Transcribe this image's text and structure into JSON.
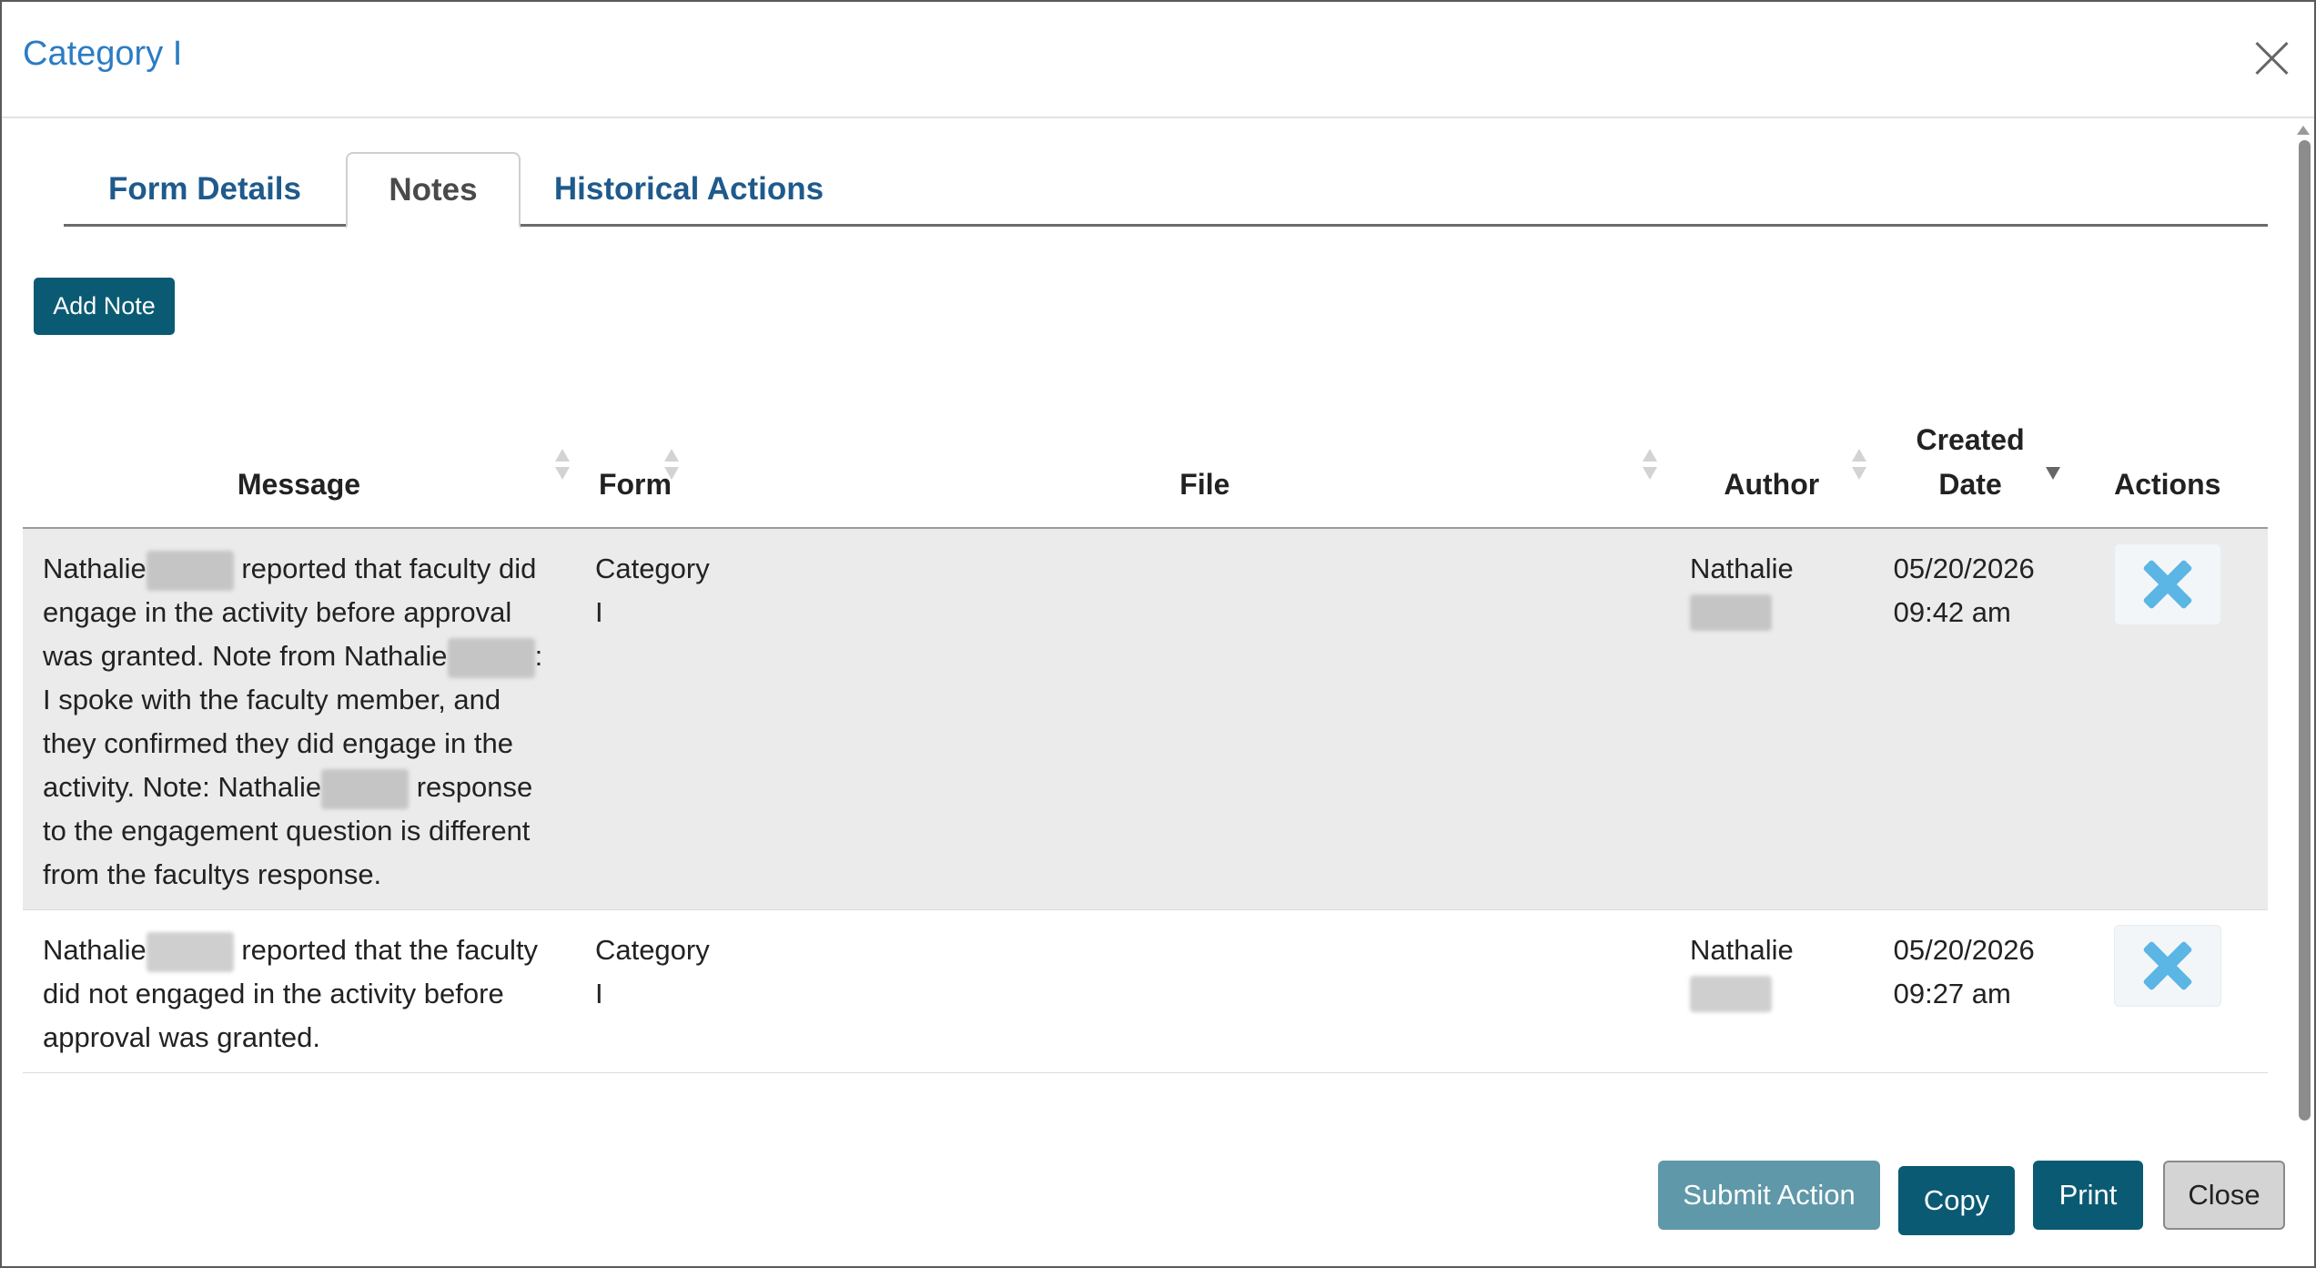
{
  "modal": {
    "title": "Category I"
  },
  "tabs": [
    {
      "label": "Form Details"
    },
    {
      "label": "Notes"
    },
    {
      "label": "Historical Actions"
    }
  ],
  "add_note_label": "Add Note",
  "table": {
    "headers": {
      "message": "Message",
      "form": "Form",
      "file": "File",
      "author": "Author",
      "created_date_line1": "Created",
      "created_date_line2": "Date",
      "actions": "Actions"
    },
    "rows": [
      {
        "message": {
          "p1": "Nathalie",
          "p2": " reported that faculty did engage in the activity before approval was granted. Note from Nathalie",
          "p3": ": I spoke with the faculty member, and they confirmed they did engage in the activity. Note: Nathalie",
          "p4": " response to the engagement question is different from the facultys response."
        },
        "form_line1": "Category",
        "form_line2": "I",
        "file": "",
        "author": "Nathalie",
        "date_line1": "05/20/2026",
        "date_line2": "09:42 am"
      },
      {
        "message": {
          "p1": "Nathalie",
          "p2": " reported that the faculty did not engaged in the activity before approval was granted."
        },
        "form_line1": "Category",
        "form_line2": "I",
        "file": "",
        "author": "Nathalie",
        "date_line1": "05/20/2026",
        "date_line2": "09:27 am"
      }
    ]
  },
  "footer": {
    "submit_action": "Submit Action",
    "copy": "Copy",
    "print": "Print",
    "close": "Close"
  },
  "colors": {
    "title_blue": "#2b7cc4",
    "tab_blue": "#1f5a8c",
    "primary_btn": "#0b5a73",
    "submit_btn_disabled": "#5f98a8",
    "delete_x": "#5bb5e5",
    "row_shade": "#ebebeb"
  },
  "icons": [
    "close-icon",
    "sort-icon",
    "delete-icon"
  ]
}
